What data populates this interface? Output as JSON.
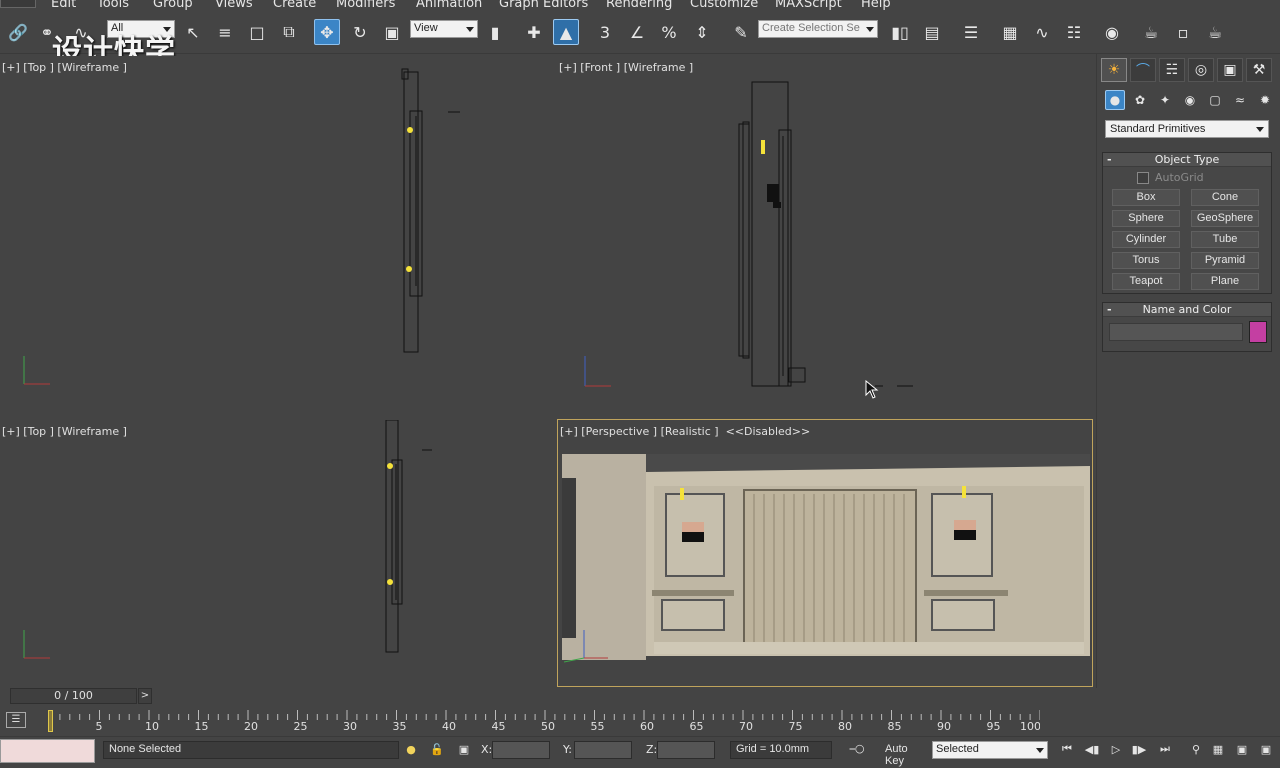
{
  "menu": {
    "items": [
      "Edit",
      "Tools",
      "Group",
      "Views",
      "Create",
      "Modifiers",
      "Animation",
      "Graph Editors",
      "Rendering",
      "Customize",
      "MAXScript",
      "Help"
    ]
  },
  "toolbar": {
    "watermark": "设计快学",
    "filter_value": "All",
    "ref_coord_value": "View",
    "selection_set_placeholder": "Create Selection Se",
    "snap_angle_label": "3",
    "icons": [
      "link-icon",
      "unlink-icon",
      "bind-spacewarp-icon",
      "select-object-icon",
      "select-by-name-icon",
      "rect-region-icon",
      "window-crossing-icon",
      "move-icon",
      "rotate-icon",
      "scale-icon",
      "pivot-center-icon",
      "manipulate-icon",
      "snap-icon",
      "angle-snap-icon",
      "percent-snap-icon",
      "spinner-snap-icon",
      "edit-named-sets-icon",
      "mirror-icon",
      "align-icon",
      "layer-manager-icon",
      "scene-explorer-icon",
      "curve-editor-icon",
      "schematic-view-icon",
      "material-editor-icon",
      "render-setup-icon",
      "rendered-frame-icon",
      "render-icon"
    ]
  },
  "viewports": {
    "top_left": {
      "label": "[+] [Top ] [Wireframe ]"
    },
    "top_right": {
      "label": "[+] [Front ] [Wireframe ]"
    },
    "bottom_left": {
      "label": "[+] [Top ] [Wireframe ]"
    },
    "bottom_right": {
      "label": "[+] [Perspective ] [Realistic ]  <<Disabled>>"
    }
  },
  "command_panel": {
    "tabs": [
      "create-tab",
      "modify-tab",
      "hierarchy-tab",
      "motion-tab",
      "display-tab",
      "utilities-tab"
    ],
    "subcategories": [
      "geometry-icon",
      "shapes-icon",
      "lights-icon",
      "cameras-icon",
      "helpers-icon",
      "spacewarps-icon",
      "systems-icon"
    ],
    "category_dropdown": "Standard Primitives",
    "object_type": {
      "title": "Object Type",
      "autogrid": "AutoGrid",
      "buttons": [
        "Box",
        "Cone",
        "Sphere",
        "GeoSphere",
        "Cylinder",
        "Tube",
        "Torus",
        "Pyramid",
        "Teapot",
        "Plane"
      ]
    },
    "name_and_color": {
      "title": "Name and Color",
      "name_value": "",
      "color": "#c43fa2"
    }
  },
  "timeline": {
    "frame_display": "0 / 100",
    "next_label": ">",
    "ticks": [
      "5",
      "10",
      "15",
      "20",
      "25",
      "30",
      "35",
      "40",
      "45",
      "50",
      "55",
      "60",
      "65",
      "70",
      "75",
      "80",
      "85",
      "90",
      "95",
      "100"
    ]
  },
  "statusbar": {
    "selection": "None Selected",
    "x_label": "X:",
    "y_label": "Y:",
    "z_label": "Z:",
    "grid": "Grid = 10.0mm",
    "auto_key": "Auto Key",
    "key_mode": "Selected"
  },
  "colors": {
    "viewport_bg": "#444444",
    "active_border": "#c0a45c",
    "accent": "#3b85c6",
    "yellow": "#f5e23a"
  }
}
